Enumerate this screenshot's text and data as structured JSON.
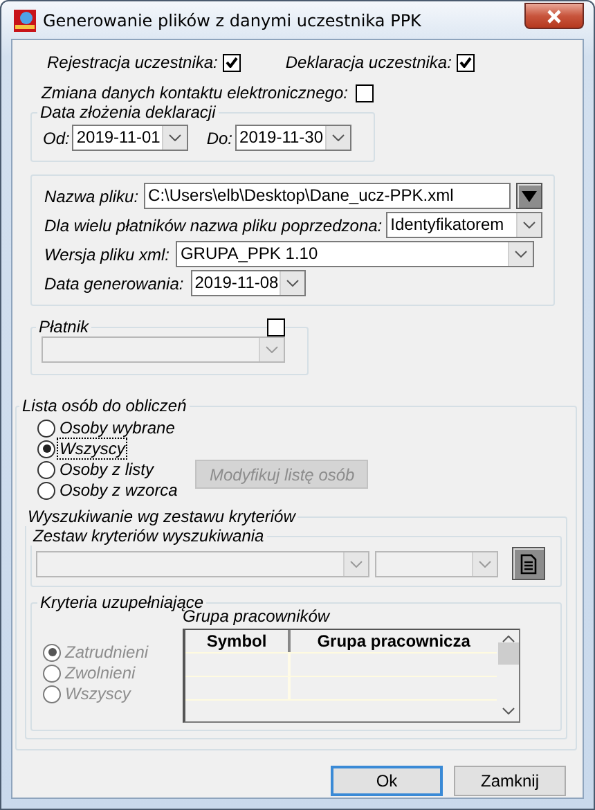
{
  "window": {
    "title": "Generowanie plików z danymi uczestnika PPK"
  },
  "options": [
    {
      "label": "Rejestracja uczestnika:",
      "checked": true
    },
    {
      "label": "Deklaracja uczestnika:",
      "checked": true
    },
    {
      "label": "Zmiana danych kontaktu elektronicznego:",
      "checked": false
    }
  ],
  "declaration_date": {
    "title": "Data złożenia deklaracji",
    "from_label": "Od:",
    "from_value": "2019-11-01",
    "to_label": "Do:",
    "to_value": "2019-11-30"
  },
  "file": {
    "name_label": "Nazwa pliku:",
    "name_value": "C:\\Users\\elb\\Desktop\\Dane_ucz-PPK.xml",
    "prefix_label": "Dla wielu płatników nazwa pliku poprzedzona:",
    "prefix_value": "Identyfikatorem",
    "version_label": "Wersja pliku xml:",
    "version_value": "GRUPA_PPK 1.10",
    "date_label": "Data generowania:",
    "date_value": "2019-11-08"
  },
  "payer": {
    "title": "Płatnik",
    "checked": false
  },
  "person_list": {
    "title": "Lista osób do obliczeń",
    "options": [
      {
        "label": "Osoby wybrane",
        "selected": false,
        "focused": false
      },
      {
        "label": "Wszyscy",
        "selected": true,
        "focused": true
      },
      {
        "label": "Osoby z listy",
        "selected": false,
        "focused": false
      },
      {
        "label": "Osoby z wzorca",
        "selected": false,
        "focused": false
      }
    ],
    "modify_button": {
      "label": "Modyfikuj listę osób",
      "disabled": true
    }
  },
  "search": {
    "title": "Wyszukiwanie wg zestawu kryteriów",
    "criteria_set_title": "Zestaw kryteriów wyszukiwania",
    "supplementary": {
      "title": "Kryteria uzupełniające",
      "disabled": true,
      "options": [
        {
          "label": "Zatrudnieni",
          "selected": true
        },
        {
          "label": "Zwolnieni",
          "selected": false
        },
        {
          "label": "Wszyscy",
          "selected": false
        }
      ]
    },
    "group": {
      "title": "Grupa pracowników",
      "columns": [
        "Symbol",
        "Grupa pracownicza"
      ]
    }
  },
  "buttons": [
    {
      "label": "Ok",
      "default": true
    },
    {
      "label": "Zamknij",
      "default": false
    }
  ]
}
